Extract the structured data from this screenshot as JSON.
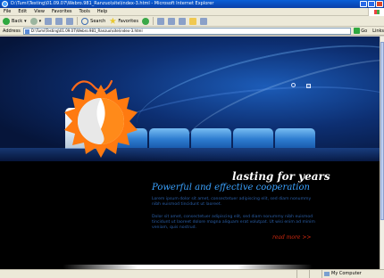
{
  "window": {
    "title": "D:\\Tumi\\Testing\\01.09.07\\Webro.981_Ranzuo\\site\\index-3.html - Microsoft Internet Explorer"
  },
  "menu": [
    "File",
    "Edit",
    "View",
    "Favorites",
    "Tools",
    "Help"
  ],
  "toolbar": {
    "back": "Back",
    "search": "Search",
    "favorites": "Favorites"
  },
  "address": {
    "label": "Address",
    "value": "D:\\Tumi\\Testing\\01.09.07\\Webro.981_Ranzuo\\site\\index-3.html",
    "go": "Go",
    "links": "Links"
  },
  "site": {
    "tagline": "lasting for years",
    "headline": "Powerful and effective cooperation",
    "para1": "Lorem ipsum dolor sit amet, consectetuer adipiscing elit, sed diam nonummy nibh euismod tincidunt ut laoreet.",
    "para2": "Dolor sit amet, consectetuer adipiscing elit, sed diam nonummy nibh euismod tincidunt ut laoreet dolore magna aliquam erat volutpat. Ut wisi enim ad minim veniam, quis nostrud.",
    "read_more": "read more >>",
    "colors": {
      "accent": "#3aa2ff",
      "link": "#d42a10",
      "hero": "#0d2f72"
    }
  },
  "status": {
    "text": "",
    "zone": "My Computer"
  }
}
